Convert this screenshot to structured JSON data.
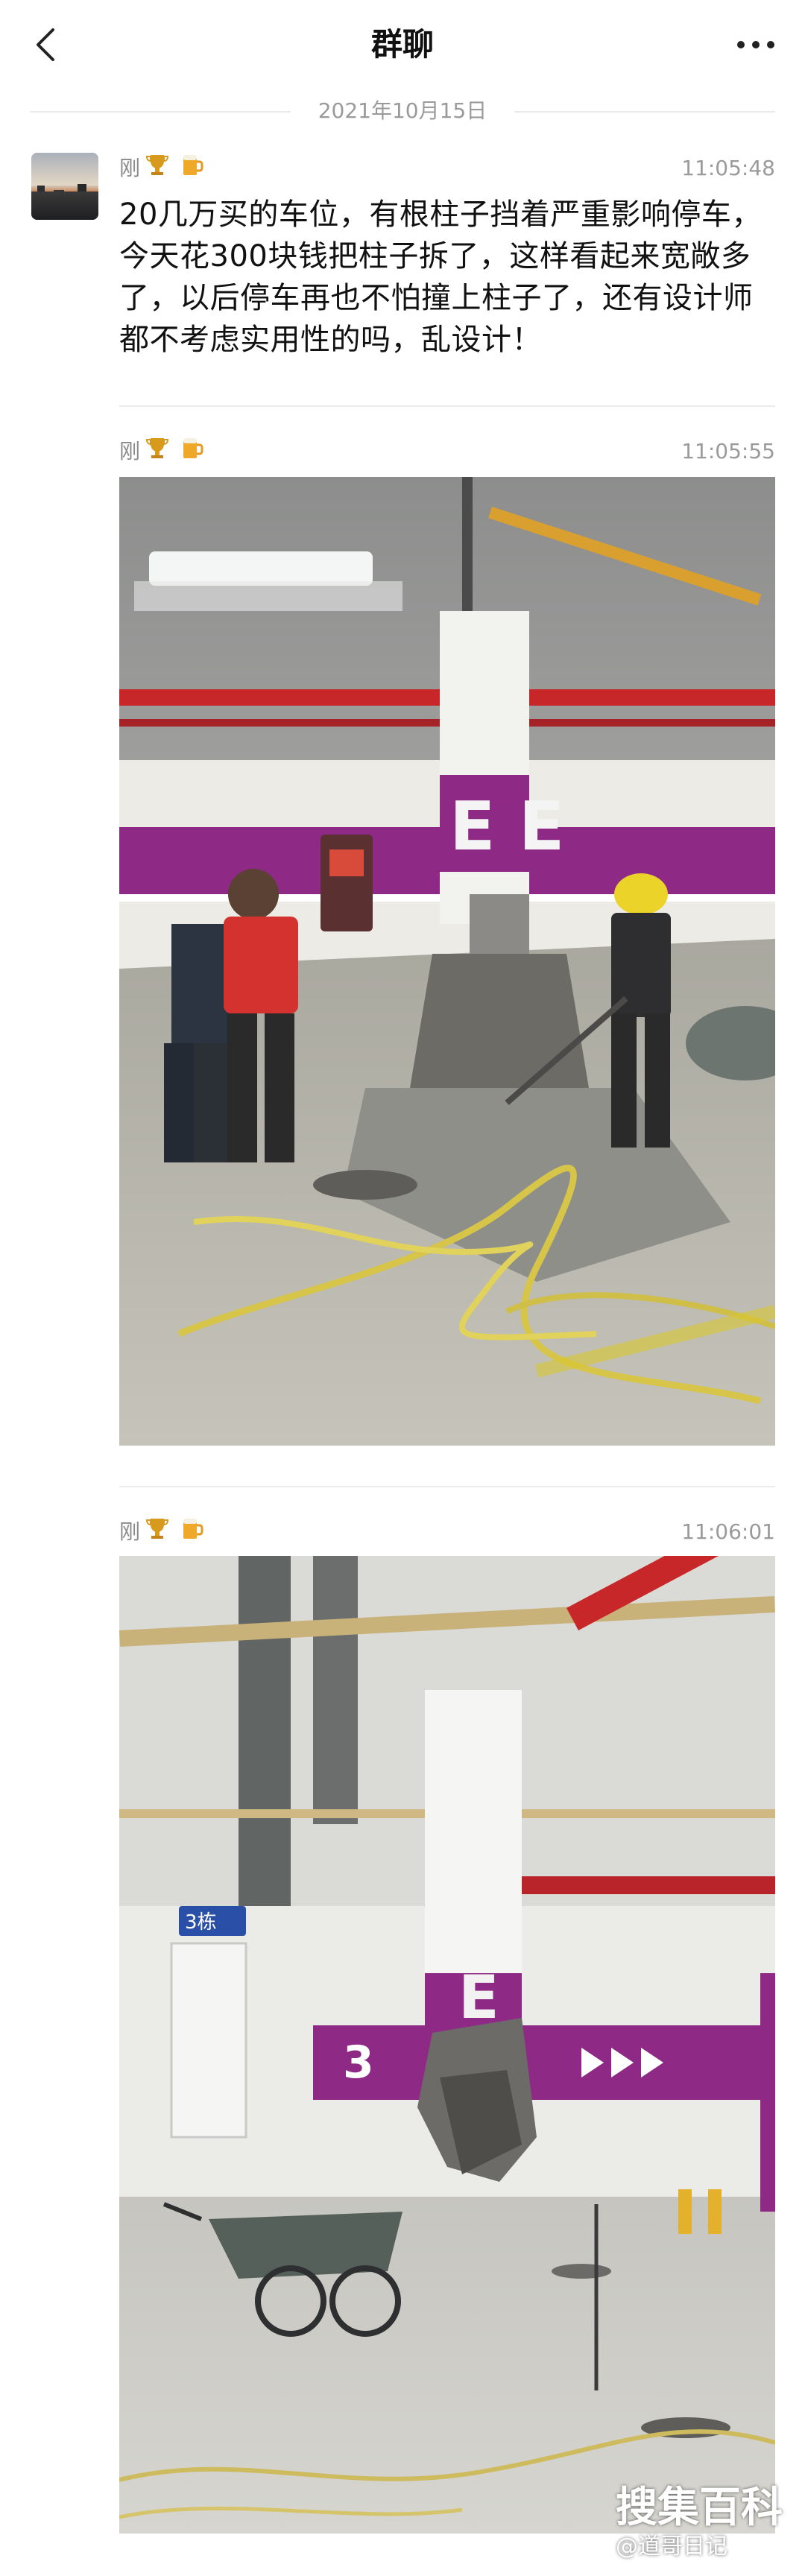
{
  "header": {
    "title": "群聊"
  },
  "date_divider": "2021年10月15日",
  "messages": [
    {
      "sender": "刚",
      "time": "11:05:48",
      "text": "20几万买的车位，有根柱子挡着严重影响停车，今天花300块钱把柱子拆了，这样看起来宽敞多了，以后停车再也不怕撞上柱子了，还有设计师都不考虑实用性的吗，乱设计！"
    },
    {
      "sender": "刚",
      "time": "11:05:55",
      "image_text": [
        "E E"
      ]
    },
    {
      "sender": "刚",
      "time": "11:06:01",
      "image_text": [
        "3栋",
        "3",
        "E"
      ]
    }
  ],
  "watermark": {
    "line1": "搜集百科",
    "line2": "@道哥日记"
  },
  "colors": {
    "purple": "#8e2a86",
    "red_pipe": "#c8272a",
    "floor_gray": "#b9b7ae"
  }
}
